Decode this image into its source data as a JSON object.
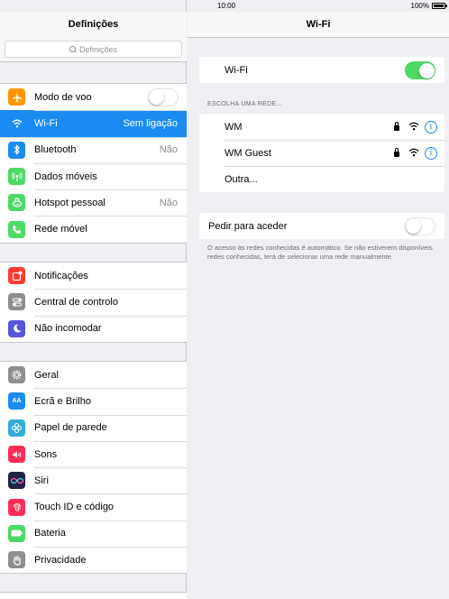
{
  "status_bar": {
    "time": "10:00",
    "battery": "100%"
  },
  "sidebar": {
    "title": "Definições",
    "search_placeholder": "Definições",
    "groups": [
      [
        {
          "label": "Modo de voo",
          "icon": "airplane-icon",
          "color": "#ff9500",
          "toggle": false
        },
        {
          "label": "Wi-Fi",
          "value": "Sem ligação",
          "icon": "wifi-icon",
          "color": "#1a8cf1",
          "selected": true
        },
        {
          "label": "Bluetooth",
          "value": "Não",
          "icon": "bluetooth-icon",
          "color": "#1a8cf1"
        },
        {
          "label": "Dados móveis",
          "icon": "antenna-icon",
          "color": "#4cd964"
        },
        {
          "label": "Hotspot pessoal",
          "value": "Não",
          "icon": "hotspot-icon",
          "color": "#4cd964"
        },
        {
          "label": "Rede móvel",
          "icon": "phone-icon",
          "color": "#4cd964"
        }
      ],
      [
        {
          "label": "Notificações",
          "icon": "notifications-icon",
          "color": "#ff3b30"
        },
        {
          "label": "Central de controlo",
          "icon": "control-center-icon",
          "color": "#8e8e93"
        },
        {
          "label": "Não incomodar",
          "icon": "moon-icon",
          "color": "#5856d6"
        }
      ],
      [
        {
          "label": "Geral",
          "icon": "gear-icon",
          "color": "#8e8e93"
        },
        {
          "label": "Ecrã e Brilho",
          "icon": "display-icon",
          "color": "#1a8cf1"
        },
        {
          "label": "Papel de parede",
          "icon": "wallpaper-icon",
          "color": "#34aadc"
        },
        {
          "label": "Sons",
          "icon": "speaker-icon",
          "color": "#ff2d55"
        },
        {
          "label": "Siri",
          "icon": "siri-icon",
          "color": "#222244"
        },
        {
          "label": "Touch ID e código",
          "icon": "fingerprint-icon",
          "color": "#ff2d55"
        },
        {
          "label": "Bateria",
          "icon": "battery-icon",
          "color": "#4cd964"
        },
        {
          "label": "Privacidade",
          "icon": "hand-icon",
          "color": "#8e8e93"
        }
      ]
    ]
  },
  "wifi_pane": {
    "title": "Wi-Fi",
    "wifi_label": "Wi-Fi",
    "wifi_on": true,
    "choose_network_label": "ESCOLHA UMA REDE...",
    "networks": [
      {
        "name": "WM",
        "secured": true
      },
      {
        "name": "WM Guest",
        "secured": true
      }
    ],
    "other_label": "Outra...",
    "ask_to_join_label": "Pedir para aceder",
    "ask_to_join_on": false,
    "footnote": "O acesso às redes conhecidas é automático. Se não estiverem disponíveis redes conhecidas, terá de selecionar uma rede manualmente."
  }
}
